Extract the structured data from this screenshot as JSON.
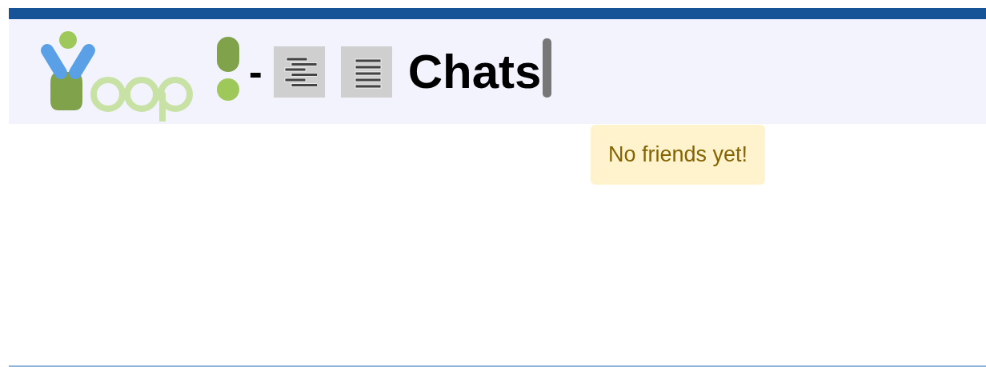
{
  "header": {
    "separator": "-",
    "buttons": [
      {
        "kind": "align-center"
      },
      {
        "kind": "align-justify"
      }
    ],
    "title": "Chats"
  },
  "alert": {
    "text": "No friends yet!"
  }
}
